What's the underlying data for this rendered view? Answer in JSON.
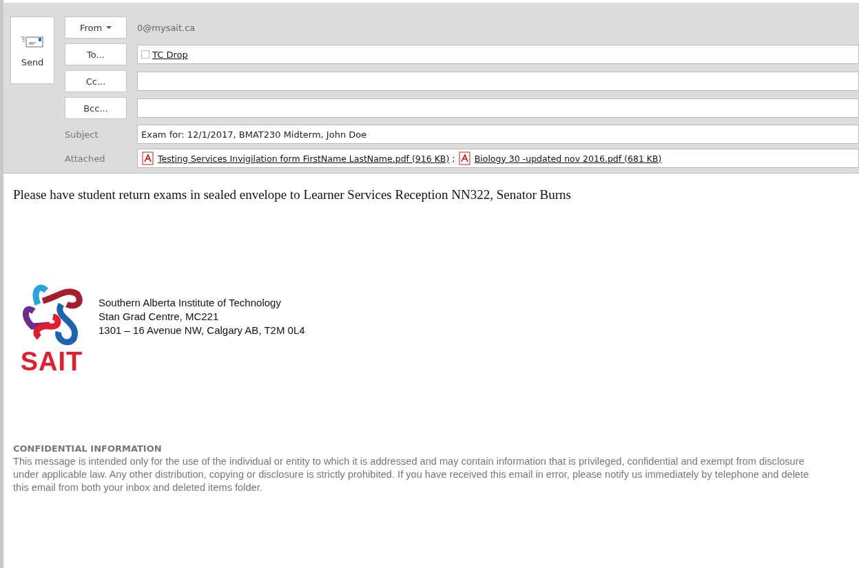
{
  "send_button": {
    "label": "Send"
  },
  "from": {
    "label": "From",
    "value": "0@mysait.ca"
  },
  "recipients": [
    {
      "label": "To...",
      "entries": [
        {
          "name": "TC Drop",
          "checked": false
        }
      ]
    },
    {
      "label": "Cc..."
    },
    {
      "label": "Bcc..."
    }
  ],
  "subject": {
    "label": "Subject",
    "value": "Exam for: 12/1/2017, BMAT230 Midterm, John Doe"
  },
  "attached": {
    "label": "Attached",
    "files": [
      {
        "name": "Testing Services Invigilation form FirstName LastName.pdf (916 KB)",
        "separator": ";"
      },
      {
        "name": "Biology 30 -updated nov 2016.pdf (681 KB)"
      }
    ]
  },
  "body": {
    "message": "Please have student return exams in sealed envelope to Learner Services Reception NN322, Senator Burns",
    "signature": {
      "logo_text": "SAIT",
      "lines": [
        "Southern Alberta Institute of Technology",
        "Stan Grad Centre, MC221",
        "1301 – 16 Avenue NW, Calgary AB, T2M 0L4"
      ]
    },
    "disclaimer": {
      "title": "CONFIDENTIAL INFORMATION",
      "text": "This message is intended only for the use of the individual or entity to which it is addressed and may contain information that is privileged, confidential and exempt from disclosure under applicable law. Any other distribution, copying or disclosure is strictly prohibited. If you have received this email in error, please notify us immediately by telephone and delete this email from both your inbox and deleted items folder."
    }
  }
}
